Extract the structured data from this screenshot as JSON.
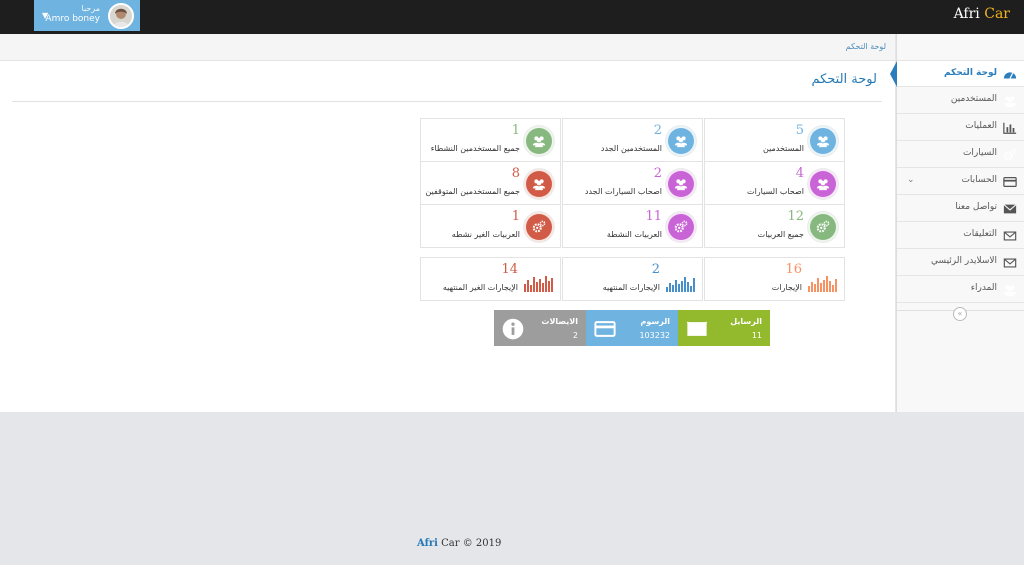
{
  "brand": {
    "part1": "Afri ",
    "part2": "Car"
  },
  "user": {
    "greeting": "مرحبا",
    "name": "Amro boney",
    "caret": "▼"
  },
  "breadcrumb": "لوحة التحكم",
  "page_title": "لوحة التحكم",
  "sidebar": {
    "items": [
      {
        "label": "لوحة التحكم",
        "icon": "dashboard-icon"
      },
      {
        "label": "المستخدمين",
        "icon": "users-icon"
      },
      {
        "label": "العمليات",
        "icon": "bar-chart-icon"
      },
      {
        "label": "السيارات",
        "icon": "cogs-icon"
      },
      {
        "label": "الحسابات",
        "icon": "credit-card-icon"
      },
      {
        "label": "تواصل معنا",
        "icon": "envelope-icon"
      },
      {
        "label": "التعليقات",
        "icon": "envelope-o-icon"
      },
      {
        "label": "الاسلايدر الرئيسي",
        "icon": "envelope-o-icon"
      },
      {
        "label": "المدراء",
        "icon": "users-icon"
      }
    ],
    "collapse": "«"
  },
  "stats": [
    {
      "value": "5",
      "label": "المستخدمين",
      "color": "#6fb3e0",
      "icon": "users-icon"
    },
    {
      "value": "2",
      "label": "المستخدمين الجدد",
      "color": "#6fb3e0",
      "icon": "users-icon"
    },
    {
      "value": "1",
      "label": "جميع المستخدمين النشطاء",
      "color": "#87b87f",
      "icon": "users-icon"
    },
    {
      "value": "4",
      "label": "اصحاب السيارات",
      "color": "#c964d6",
      "icon": "users-icon"
    },
    {
      "value": "2",
      "label": "اصحاب السيارات الجدد",
      "color": "#c964d6",
      "icon": "users-icon"
    },
    {
      "value": "8",
      "label": "جميع المستخدمين المتوقفين",
      "color": "#d15b47",
      "icon": "users-icon"
    },
    {
      "value": "12",
      "label": "جميع العربيات",
      "color": "#87b87f",
      "icon": "cogs-icon"
    },
    {
      "value": "11",
      "label": "العربيات النشطة",
      "color": "#c964d6",
      "icon": "cogs-icon"
    },
    {
      "value": "1",
      "label": "العربيات الغير نشطه",
      "color": "#d15b47",
      "icon": "cogs-icon"
    }
  ],
  "bar_stats": [
    {
      "value": "16",
      "label": "الإيجارات",
      "color": "#f79263"
    },
    {
      "value": "2",
      "label": "الإيجارات المنتهيه",
      "color": "#478fca"
    },
    {
      "value": "14",
      "label": "الإيجارات الغير المنتهيه",
      "color": "#d15b47"
    }
  ],
  "tiles": [
    {
      "label": "الرسايل",
      "value": "11",
      "color": "#93b92d",
      "icon": "envelope-icon"
    },
    {
      "label": "الرسوم",
      "value": "103232",
      "color": "#6fb3e0",
      "icon": "credit-card-icon"
    },
    {
      "label": "الايصالات",
      "value": "2",
      "color": "#9d9d9d",
      "icon": "info-icon"
    }
  ],
  "footer": {
    "part1": "Afri",
    "part2": " Car © 2019"
  }
}
